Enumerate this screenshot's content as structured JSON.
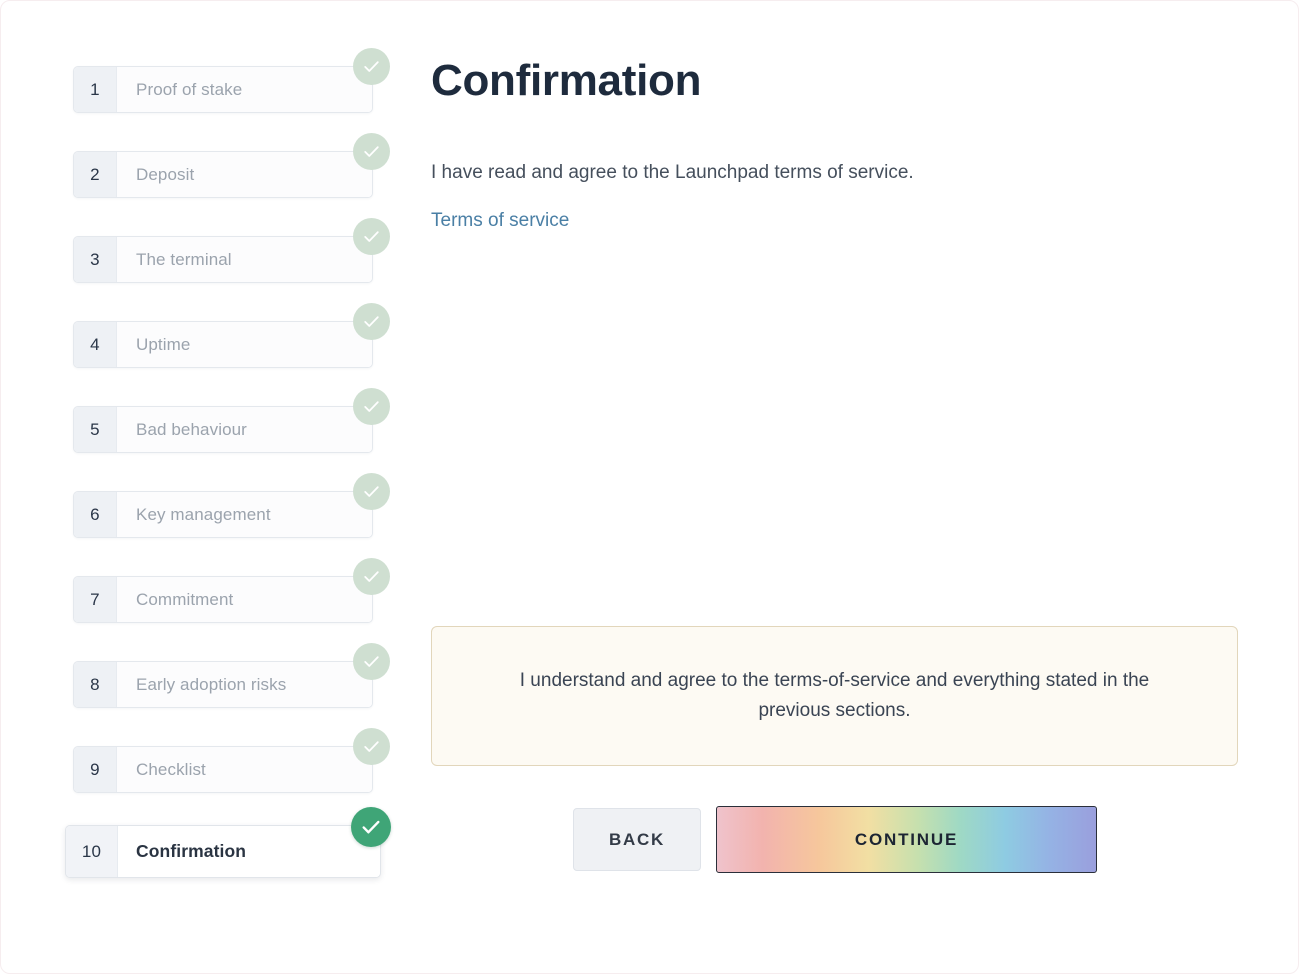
{
  "wizard": {
    "steps": [
      {
        "number": "1",
        "label": "Proof of stake",
        "state": "complete"
      },
      {
        "number": "2",
        "label": "Deposit",
        "state": "complete"
      },
      {
        "number": "3",
        "label": "The terminal",
        "state": "complete"
      },
      {
        "number": "4",
        "label": "Uptime",
        "state": "complete"
      },
      {
        "number": "5",
        "label": "Bad behaviour",
        "state": "complete"
      },
      {
        "number": "6",
        "label": "Key management",
        "state": "complete"
      },
      {
        "number": "7",
        "label": "Commitment",
        "state": "complete"
      },
      {
        "number": "8",
        "label": "Early adoption risks",
        "state": "complete"
      },
      {
        "number": "9",
        "label": "Checklist",
        "state": "complete"
      },
      {
        "number": "10",
        "label": "Confirmation",
        "state": "active"
      }
    ],
    "badge_icon": "check-icon",
    "total_steps": 10,
    "current_step": 10
  },
  "main": {
    "title": "Confirmation",
    "intro": "I have read and agree to the Launchpad terms of service.",
    "terms_link_label": "Terms of service",
    "agreement_notice": "I understand and agree to the terms-of-service and everything stated in the previous sections."
  },
  "actions": {
    "back_label": "BACK",
    "continue_label": "CONTINUE"
  },
  "colors": {
    "heading": "#1e2b3d",
    "link": "#4a7fa5",
    "badge_complete": "#cfdfd1",
    "badge_active": "#3fa577",
    "notice_bg": "#fdfaf3",
    "notice_border": "#e2d6bb",
    "step_number_bg": "#eef1f5",
    "back_button_bg": "#eff1f4"
  }
}
